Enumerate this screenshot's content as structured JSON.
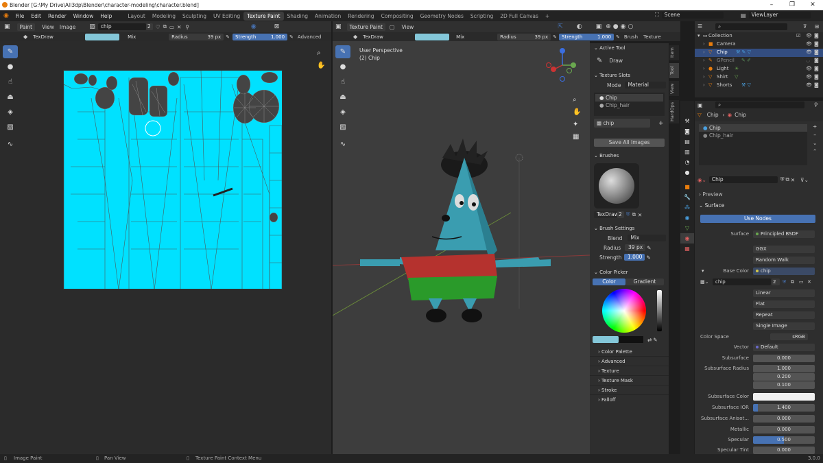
{
  "window": {
    "title": "Blender [G:\\My Drive\\All3dp\\Blender\\character-modeling\\character.blend]"
  },
  "menu": [
    "File",
    "Edit",
    "Render",
    "Window",
    "Help"
  ],
  "workspaces": [
    "Layout",
    "Modeling",
    "Sculpting",
    "UV Editing",
    "Texture Paint",
    "Shading",
    "Animation",
    "Rendering",
    "Compositing",
    "Geometry Nodes",
    "Scripting",
    "2D Full Canvas",
    "+"
  ],
  "active_workspace": "Texture Paint",
  "scene": {
    "name": "Scene",
    "view_layer": "ViewLayer"
  },
  "image_editor": {
    "mode": "Paint",
    "view": "View",
    "image": "Image",
    "image_name": "chip",
    "users": "2",
    "brush": "TexDraw",
    "blend": "Mix",
    "radius_label": "Radius",
    "radius": "39 px",
    "strength_label": "Strength",
    "strength": "1.000",
    "advanced": "Advanced"
  },
  "viewport": {
    "mode": "Texture Paint",
    "view": "View",
    "brush": "TexDraw",
    "blend": "Mix",
    "radius_label": "Radius",
    "radius": "39 px",
    "strength_label": "Strength",
    "strength": "1.000",
    "brush_menu": "Brush",
    "texture_menu": "Texture",
    "perspective": "User Perspective",
    "object": "(2) Chip"
  },
  "npanel": {
    "active_tool": "Active Tool",
    "draw": "Draw",
    "texture_slots": "Texture Slots",
    "mode_label": "Mode",
    "mode_value": "Material",
    "slots": [
      "Chip",
      "Chip_hair"
    ],
    "image_slot": "chip",
    "save_all": "Save All Images",
    "brushes": "Brushes",
    "brush_name": "TexDraw",
    "brush_users": "2",
    "brush_settings": "Brush Settings",
    "blend_label": "Blend",
    "blend_value": "Mix",
    "radius_label": "Radius",
    "radius_value": "39 px",
    "strength_label": "Strength",
    "strength_value": "1.000",
    "color_picker": "Color Picker",
    "color_tab": "Color",
    "gradient_tab": "Gradient",
    "collapsed": [
      "Color Palette",
      "Advanced",
      "Texture",
      "Texture Mask",
      "Stroke",
      "Falloff"
    ]
  },
  "sidebar_tabs": [
    "Item",
    "Tool",
    "View",
    "HardOps"
  ],
  "outliner": {
    "collection": "Collection",
    "items": [
      "Camera",
      "Chip",
      "GPencil",
      "Light",
      "Shirt",
      "Shorts"
    ]
  },
  "properties": {
    "breadcrumb_object": "Chip",
    "breadcrumb_material": "Chip",
    "materials": [
      "Chip",
      "Chip_hair"
    ],
    "material_name": "Chip",
    "preview": "Preview",
    "surface": "Surface",
    "use_nodes": "Use Nodes",
    "surface_label": "Surface",
    "surface_value": "Principled BSDF",
    "distribution": "GGX",
    "subsurface_method": "Random Walk",
    "base_color_label": "Base Color",
    "base_color_value": "chip",
    "image_name": "chip",
    "image_users": "2",
    "interpolation": "Linear",
    "projection": "Flat",
    "extension": "Repeat",
    "source": "Single Image",
    "color_space_label": "Color Space",
    "color_space_value": "sRGB",
    "vector_label": "Vector",
    "vector_value": "Default",
    "subsurface_label": "Subsurface",
    "subsurface_value": "0.000",
    "ss_radius_label": "Subsurface Radius",
    "ss_radius": [
      "1.000",
      "0.200",
      "0.100"
    ],
    "ss_color_label": "Subsurface Color",
    "ss_ior_label": "Subsurface IOR",
    "ss_ior_value": "1.400",
    "ss_aniso_label": "Subsurface Anisot...",
    "ss_aniso_value": "0.000",
    "metallic_label": "Metallic",
    "metallic_value": "0.000",
    "specular_label": "Specular",
    "specular_value": "0.500",
    "spec_tint_label": "Specular Tint",
    "spec_tint_value": "0.000"
  },
  "status": {
    "left": "Image Paint",
    "middle": "Pan View",
    "right": "Texture Paint Context Menu",
    "version": "3.0.0"
  },
  "colors": {
    "accent": "#4772b3",
    "paint_color": "#84c7d9",
    "uv_bg": "#00e1ff"
  }
}
